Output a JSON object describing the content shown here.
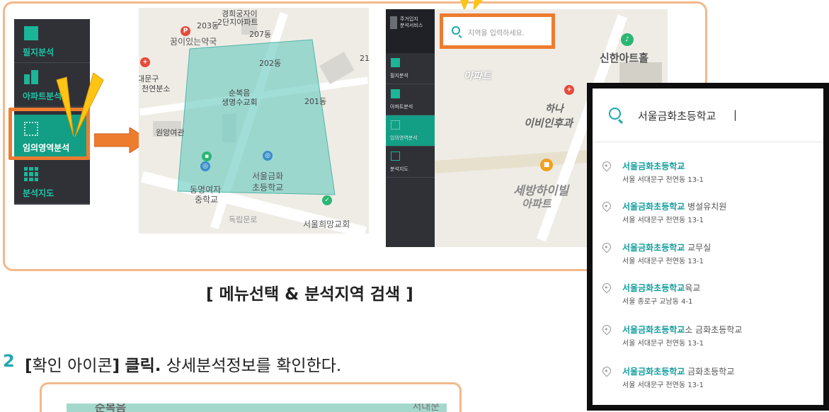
{
  "sidebar": {
    "items": [
      {
        "label": "필지분석",
        "icon": "layers-icon"
      },
      {
        "label": "아파트분석",
        "icon": "building-icon"
      },
      {
        "label": "임의영역분석",
        "icon": "dotted-area-icon"
      },
      {
        "label": "분석지도",
        "icon": "grid-map-icon"
      }
    ],
    "active_index": 2
  },
  "map": {
    "labels": [
      "경희궁자이",
      "2단지아파트",
      "203동",
      "207동",
      "꿈이있는약국",
      "202동",
      "대문구",
      "천연분소",
      "순복음",
      "생명수교회",
      "201동",
      "원앙여관",
      "동명여자",
      "중학교",
      "서울금화",
      "초등학교",
      "독립문로",
      "서울희망교회",
      "21"
    ]
  },
  "app2": {
    "brand": [
      "주거입지",
      "분석서비스"
    ],
    "sidebar": [
      "필지분석",
      "아파트분석",
      "임의영역분석",
      "분석지도"
    ],
    "search_placeholder": "지역을 입력하세요.",
    "map_labels": [
      "아파트",
      "신한아트홀",
      "하나",
      "이비인후과",
      "세방하이빌",
      "아파트"
    ]
  },
  "popup": {
    "query": "서울금화초등학교",
    "results": [
      {
        "match": "서울금화초등학교",
        "rest": "",
        "address": "서울 서대문구 천연동 13-1"
      },
      {
        "match": "서울금화초등학교",
        "rest": " 병설유치원",
        "address": "서울 서대문구 천연동 13-1"
      },
      {
        "match": "서울금화초등학교",
        "rest": " 교무실",
        "address": "서울 서대문구 천연동 13-1"
      },
      {
        "match": "서울금화초등학교",
        "rest": "육교",
        "address": "서울 종로구 교남동 4-1"
      },
      {
        "match": "서울금화초등학교",
        "rest": "소 금화초등학교",
        "address": "서울 서대문구 천연동 13-1"
      },
      {
        "match": "서울금화초등학교",
        "rest": " 금화초등학교",
        "address": "서울 서대문구 천연동 13-1"
      }
    ]
  },
  "caption": "[ 메뉴선택 & 분석지역 검색 ]",
  "step": {
    "number": "2",
    "bracket_open": "[",
    "icon_label": "확인 아이콘",
    "bracket_close": "]",
    "action": "클릭.",
    "description": "상세분석정보를 확인한다."
  },
  "preview": {
    "left_label": "순복음",
    "right_label": "서대문"
  },
  "colors": {
    "accent": "#ee7c2f",
    "teal": "#1bb598",
    "sidebar_bg": "#2f3137",
    "frame": "#f2b98b",
    "link": "#149d9e"
  }
}
